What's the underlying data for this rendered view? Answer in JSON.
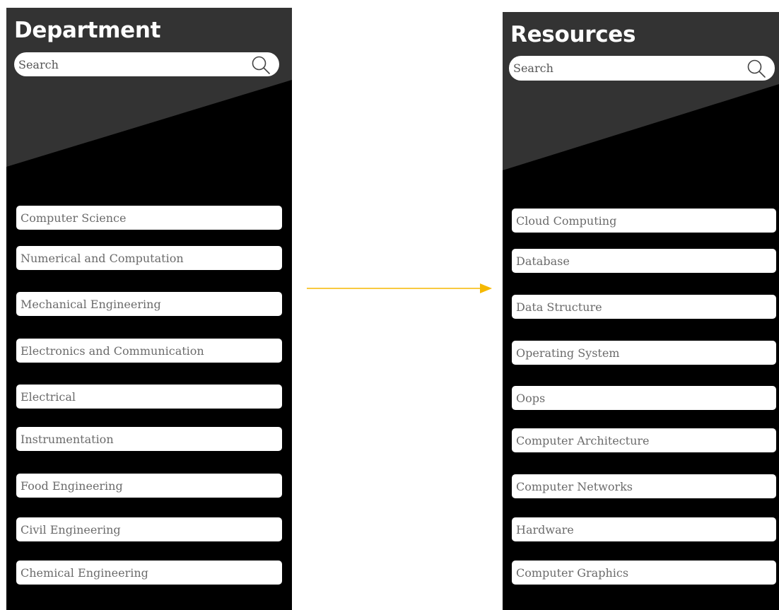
{
  "department_screen": {
    "title": "Department",
    "search": {
      "placeholder": "Search"
    },
    "items": [
      {
        "label": "Computer Science"
      },
      {
        "label": "Numerical and Computation"
      },
      {
        "label": "Mechanical Engineering"
      },
      {
        "label": "Electronics and Communication"
      },
      {
        "label": "Electrical"
      },
      {
        "label": "Instrumentation"
      },
      {
        "label": "Food Engineering"
      },
      {
        "label": "Civil Engineering"
      },
      {
        "label": "Chemical Engineering"
      }
    ]
  },
  "resources_screen": {
    "title": "Resources",
    "search": {
      "placeholder": "Search"
    },
    "items": [
      {
        "label": "Cloud Computing"
      },
      {
        "label": "Database"
      },
      {
        "label": "Data Structure"
      },
      {
        "label": "Operating System"
      },
      {
        "label": "Oops"
      },
      {
        "label": "Computer Architecture"
      },
      {
        "label": "Computer Networks"
      },
      {
        "label": "Hardware"
      },
      {
        "label": "Computer Graphics"
      }
    ]
  },
  "colors": {
    "screen_bg": "#000000",
    "header_bg": "#333333",
    "item_bg": "#ffffff",
    "item_text": "#6b6b6b",
    "arrow": "#f5b800"
  },
  "icons": {
    "search": "search-icon",
    "arrow": "arrow-right-icon"
  }
}
